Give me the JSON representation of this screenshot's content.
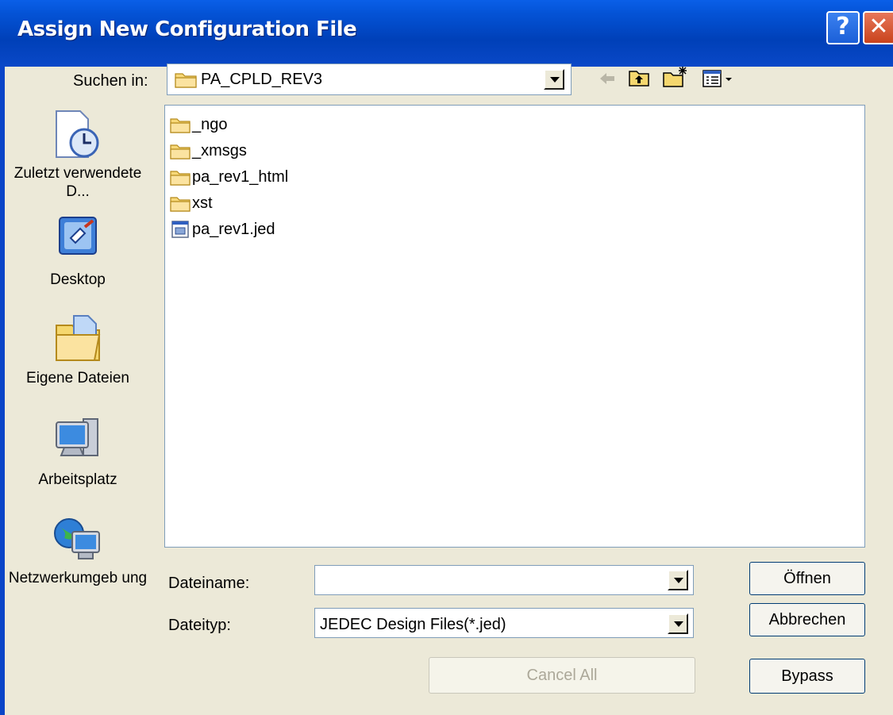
{
  "window": {
    "title": "Assign New Configuration File"
  },
  "titlebar": {
    "help_glyph": "?",
    "close_glyph": "✕"
  },
  "lookin": {
    "label": "Suchen in:",
    "value": "PA_CPLD_REV3"
  },
  "toolbar": {
    "icons": [
      "back-arrow-icon",
      "up-folder-icon",
      "new-folder-icon",
      "view-menu-icon"
    ]
  },
  "places": [
    {
      "label": "Zuletzt verwendete D...",
      "icon": "recent-documents-icon"
    },
    {
      "label": "Desktop",
      "icon": "desktop-icon"
    },
    {
      "label": "Eigene Dateien",
      "icon": "my-documents-icon"
    },
    {
      "label": "Arbeitsplatz",
      "icon": "my-computer-icon"
    },
    {
      "label": "Netzwerkumgeb ung",
      "icon": "network-icon"
    }
  ],
  "files": [
    {
      "name": "_ngo",
      "type": "folder"
    },
    {
      "name": "_xmsgs",
      "type": "folder"
    },
    {
      "name": "pa_rev1_html",
      "type": "folder"
    },
    {
      "name": "xst",
      "type": "folder"
    },
    {
      "name": "pa_rev1.jed",
      "type": "file"
    }
  ],
  "filename": {
    "label": "Dateiname:",
    "value": ""
  },
  "filetype": {
    "label": "Dateityp:",
    "value": "JEDEC Design Files(*.jed)"
  },
  "buttons": {
    "open": "Öffnen",
    "cancel": "Abbrechen",
    "cancel_all": "Cancel All",
    "bypass": "Bypass"
  },
  "colors": {
    "titlebar": "#0453D6",
    "dialog_bg": "#ECE9D8",
    "folder_yellow": "#F5D76E"
  }
}
